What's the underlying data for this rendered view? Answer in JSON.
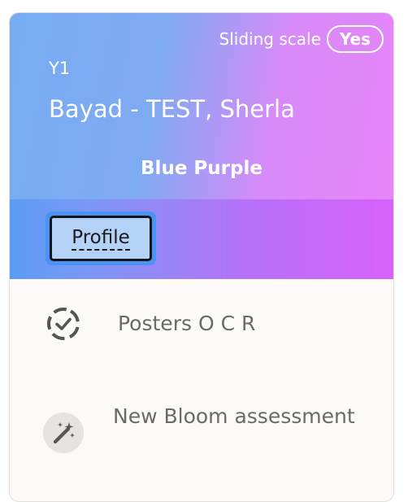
{
  "header": {
    "sliding_scale_label": "Sliding scale",
    "sliding_scale_value": "Yes",
    "year_level": "Y1",
    "student_name": "Bayad - TEST, Sherla",
    "group_name": "Blue Purple"
  },
  "tabs": {
    "active_label": "Profile"
  },
  "items": [
    {
      "label": "Posters O C R",
      "icon": "dashed-check-circle-icon"
    },
    {
      "label": "New Bloom assessment",
      "icon": "magic-wand-icon"
    }
  ],
  "colors": {
    "header_gradient_start": "#78acf2",
    "header_gradient_end": "#e685f9",
    "tab_focus": "#4a92f3",
    "tab_bg": "#b4d2f8",
    "item_text": "#6a6a6a"
  }
}
